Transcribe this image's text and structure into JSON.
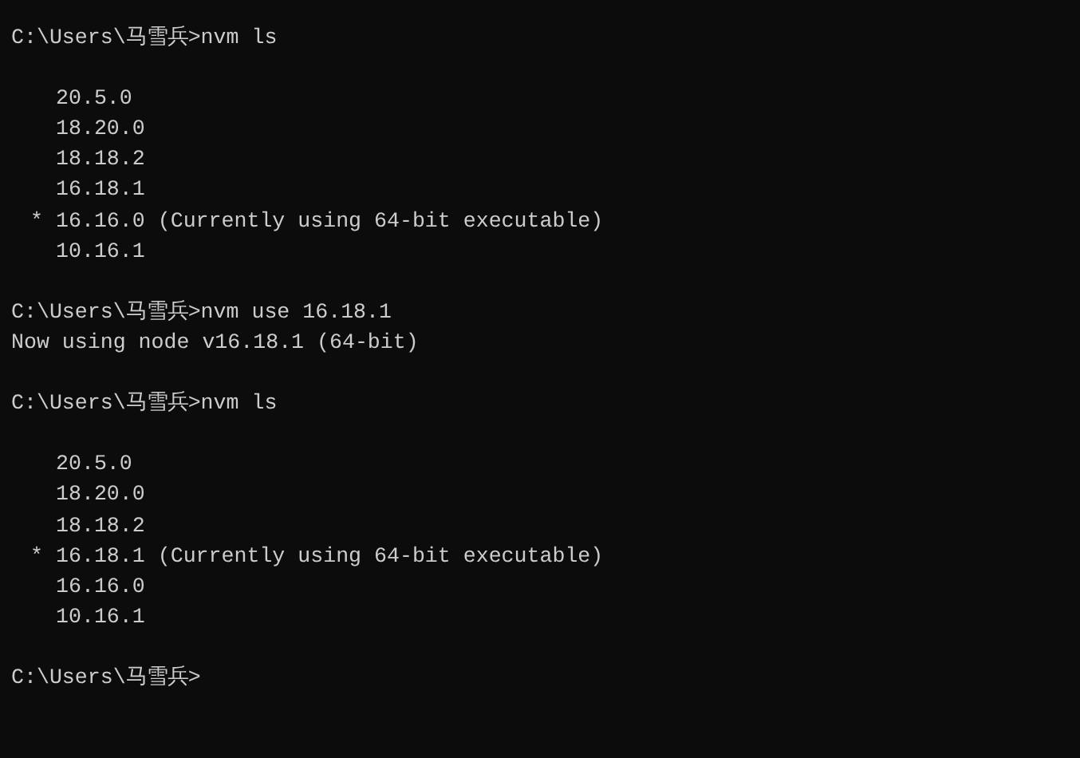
{
  "terminal": {
    "lines": [
      {
        "kind": "prompt",
        "prompt": "C:\\Users\\马雪兵>",
        "command": "nvm ls"
      },
      {
        "kind": "blank"
      },
      {
        "kind": "version",
        "version": "20.5.0"
      },
      {
        "kind": "version",
        "version": "18.20.0"
      },
      {
        "kind": "version",
        "version": "18.18.2"
      },
      {
        "kind": "version",
        "version": "16.18.1"
      },
      {
        "kind": "version",
        "marker": "*",
        "version": "16.16.0",
        "note": "(Currently using 64-bit executable)"
      },
      {
        "kind": "version",
        "version": "10.16.1"
      },
      {
        "kind": "blank"
      },
      {
        "kind": "prompt",
        "prompt": "C:\\Users\\马雪兵>",
        "command": "nvm use 16.18.1"
      },
      {
        "kind": "output",
        "text": "Now using node v16.18.1 (64-bit)"
      },
      {
        "kind": "blank"
      },
      {
        "kind": "prompt",
        "prompt": "C:\\Users\\马雪兵>",
        "command": "nvm ls"
      },
      {
        "kind": "blank"
      },
      {
        "kind": "version",
        "version": "20.5.0"
      },
      {
        "kind": "version",
        "version": "18.20.0"
      },
      {
        "kind": "version",
        "version": "18.18.2"
      },
      {
        "kind": "version",
        "marker": "*",
        "version": "16.18.1",
        "note": "(Currently using 64-bit executable)"
      },
      {
        "kind": "version",
        "version": "16.16.0"
      },
      {
        "kind": "version",
        "version": "10.16.1"
      },
      {
        "kind": "blank"
      },
      {
        "kind": "prompt",
        "prompt": "C:\\Users\\马雪兵>"
      }
    ]
  }
}
